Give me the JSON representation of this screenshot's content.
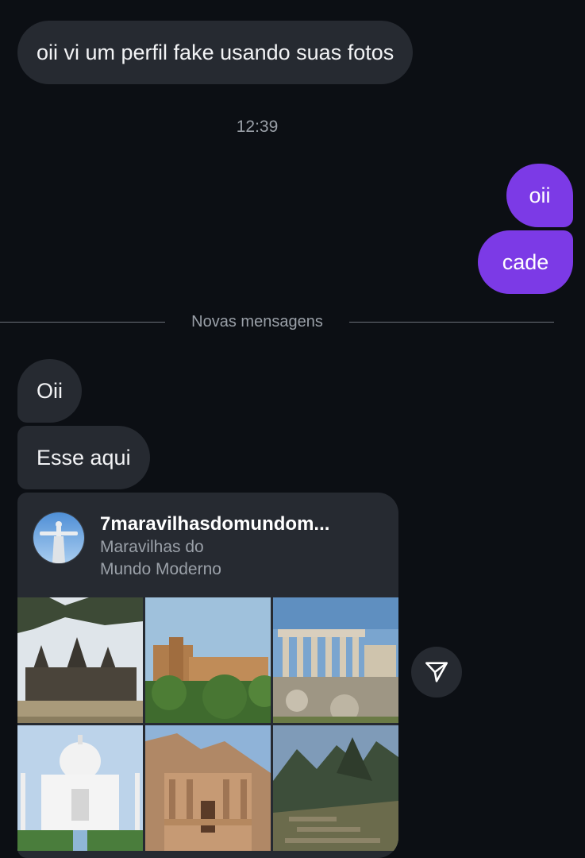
{
  "messages": {
    "received_1": "oii vi um perfil fake usando suas fotos",
    "timestamp": "12:39",
    "sent_1": "oii",
    "sent_2": "cade",
    "new_messages_label": "Novas mensagens",
    "received_2": "Oii",
    "received_3": "Esse aqui"
  },
  "shared_profile": {
    "username": "7maravilhasdomundom...",
    "bio_line_1": "Maravilhas do",
    "bio_line_2": "Mundo Moderno",
    "grid_images": [
      "angkor-wat-photo",
      "alhambra-photo",
      "acropolis-erechtheion-photo",
      "taj-mahal-photo",
      "petra-treasury-photo",
      "machu-picchu-photo"
    ]
  },
  "icons": {
    "share": "send-paper-plane-icon",
    "avatar": "christ-the-redeemer-avatar"
  },
  "colors": {
    "background": "#0c0f14",
    "received_bubble": "#262a31",
    "sent_bubble": "#7c3ae6",
    "muted_text": "#9aa0a8"
  }
}
